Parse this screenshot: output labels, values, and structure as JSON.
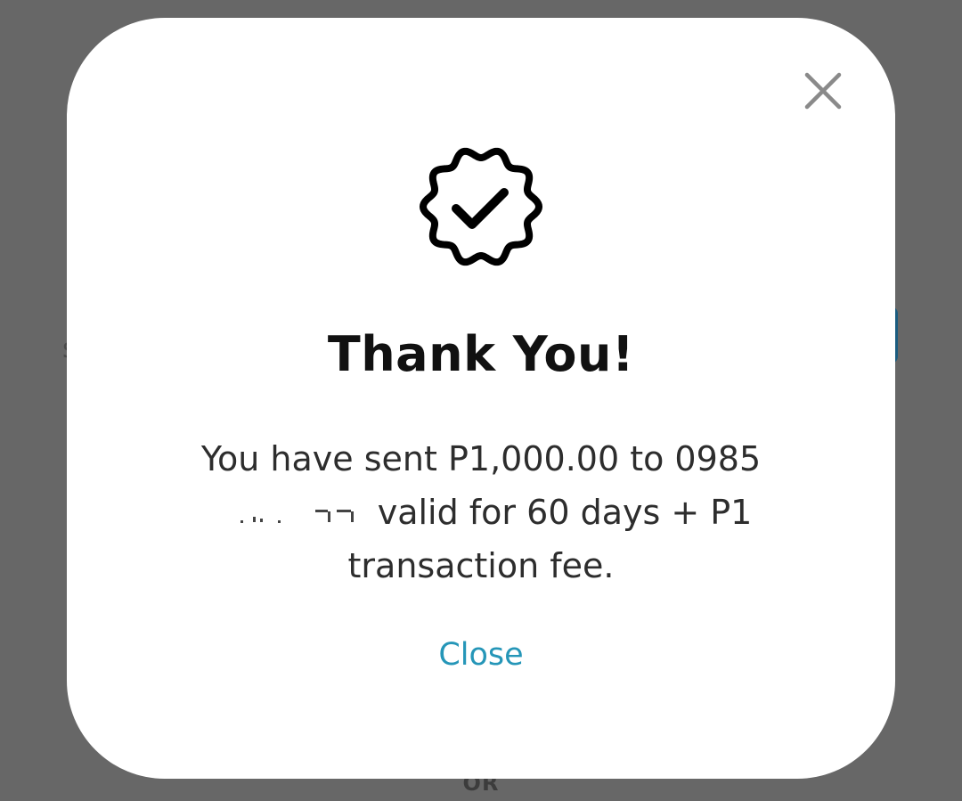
{
  "background": {
    "overlay_color": "#676767",
    "partial_text_bottom": "OR",
    "partial_glyph_left": "s"
  },
  "dialog": {
    "close_icon": "close-icon",
    "badge_icon": "verified-badge-check-icon",
    "title": "Thank You!",
    "message": {
      "line1": "You have sent P1,000.00 to 0985",
      "line2": "valid for 60 days + P1",
      "line3": "transaction fee."
    },
    "close_link_label": "Close",
    "accent_color": "#2596b8",
    "title_color": "#111111",
    "text_color": "#2d2d2d"
  }
}
